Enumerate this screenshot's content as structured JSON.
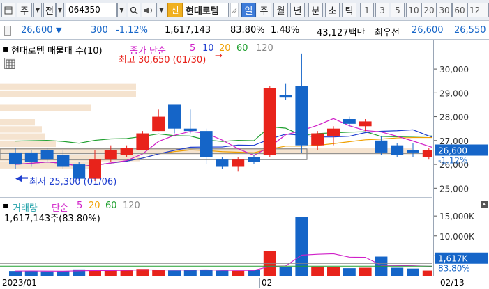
{
  "toolbar": {
    "type_label": "주",
    "exchange_label": "전",
    "code": "064350",
    "new_badge": "신",
    "stock_name": "현대로템",
    "periods": [
      "일",
      "주",
      "월",
      "년",
      "분",
      "초",
      "틱"
    ],
    "active_period": "일",
    "intervals": [
      "1",
      "3",
      "5",
      "10",
      "20",
      "30",
      "60",
      "12"
    ]
  },
  "info": {
    "price": "26,600",
    "change_arrow": "▼",
    "change": "300",
    "change_pct": "-1.12%",
    "volume": "1,617,143",
    "vol_ratio": "83.80%",
    "turnover": "1.48%",
    "trade_value": "43,127백만",
    "best_offer_label": "최우선",
    "best_ask": "26,600",
    "best_bid": "26,550"
  },
  "price_panel": {
    "title": "현대로템 매물대 수(10)",
    "ma_label": "종가 단순",
    "ma_periods": [
      "5",
      "10",
      "20",
      "60",
      "120"
    ],
    "high_note": "최고 30,650 (01/30)",
    "low_note": "최저 25,300 (01/06)",
    "y_ticks": [
      "30,000",
      "29,000",
      "28,000",
      "27,000",
      "26,000",
      "25,000"
    ],
    "current_tag": "26,600",
    "change_tag": "-1.12%"
  },
  "volume_panel": {
    "title": "거래량",
    "ma_label": "단순",
    "ma_periods": [
      "5",
      "20",
      "60",
      "120"
    ],
    "value_text": "1,617,143주(83.80%)",
    "y_ticks": [
      "15,000K",
      "10,000K",
      "5,000K"
    ],
    "current_tag": "1,617K",
    "ratio_tag": "83.80%"
  },
  "date_axis": {
    "start": "2023/01",
    "mid": "02",
    "end": "02/13"
  },
  "colors": {
    "up": "#e8231b",
    "down": "#1565c8",
    "ma5": "#d01fc8",
    "ma10": "#1f3fd0",
    "ma20": "#f0a000",
    "ma60": "#20a030",
    "ma120": "#777777",
    "volume_profile": "#f5e3cf"
  },
  "chart_data": {
    "type": "candlestick",
    "dates": [
      "01/02",
      "01/03",
      "01/04",
      "01/05",
      "01/06",
      "01/09",
      "01/10",
      "01/11",
      "01/12",
      "01/13",
      "01/16",
      "01/17",
      "01/18",
      "01/19",
      "01/20",
      "01/25",
      "01/26",
      "01/27",
      "01/30",
      "01/31",
      "02/01",
      "02/02",
      "02/03",
      "02/06",
      "02/07",
      "02/08",
      "02/09",
      "02/10",
      "02/13"
    ],
    "candles": [
      {
        "open": 26500,
        "high": 26700,
        "low": 25800,
        "close": 26000
      },
      {
        "open": 26500,
        "high": 26600,
        "low": 25900,
        "close": 26100
      },
      {
        "open": 26600,
        "high": 26700,
        "low": 26100,
        "close": 26200
      },
      {
        "open": 26400,
        "high": 26600,
        "low": 25800,
        "close": 25900
      },
      {
        "open": 26000,
        "high": 26100,
        "low": 25300,
        "close": 25400
      },
      {
        "open": 25400,
        "high": 26600,
        "low": 25300,
        "close": 26200
      },
      {
        "open": 26200,
        "high": 26800,
        "low": 26100,
        "close": 26600
      },
      {
        "open": 26400,
        "high": 26800,
        "low": 26300,
        "close": 26700
      },
      {
        "open": 26600,
        "high": 27400,
        "low": 26600,
        "close": 27300
      },
      {
        "open": 27400,
        "high": 28300,
        "low": 27400,
        "close": 28000
      },
      {
        "open": 28500,
        "high": 28500,
        "low": 27300,
        "close": 27500
      },
      {
        "open": 27500,
        "high": 28300,
        "low": 27300,
        "close": 27400
      },
      {
        "open": 27400,
        "high": 27500,
        "low": 26000,
        "close": 26300
      },
      {
        "open": 26200,
        "high": 26300,
        "low": 25800,
        "close": 25900
      },
      {
        "open": 25900,
        "high": 26300,
        "low": 25700,
        "close": 26200
      },
      {
        "open": 26300,
        "high": 26400,
        "low": 26000,
        "close": 26100
      },
      {
        "open": 26400,
        "high": 29300,
        "low": 26300,
        "close": 29200
      },
      {
        "open": 28900,
        "high": 29400,
        "low": 28700,
        "close": 28800
      },
      {
        "open": 29300,
        "high": 30650,
        "low": 26500,
        "close": 26800
      },
      {
        "open": 26800,
        "high": 27400,
        "low": 26600,
        "close": 27300
      },
      {
        "open": 27200,
        "high": 27600,
        "low": 26800,
        "close": 27500
      },
      {
        "open": 27900,
        "high": 28000,
        "low": 27600,
        "close": 27700
      },
      {
        "open": 27600,
        "high": 27900,
        "low": 27400,
        "close": 27800
      },
      {
        "open": 27000,
        "high": 27200,
        "low": 26400,
        "close": 26500
      },
      {
        "open": 26800,
        "high": 26900,
        "low": 26300,
        "close": 26400
      },
      {
        "open": 26600,
        "high": 26900,
        "low": 26300,
        "close": 26500
      },
      {
        "open": 26300,
        "high": 26700,
        "low": 26200,
        "close": 26600
      },
      {
        "open": 26600,
        "high": 26900,
        "low": 26400,
        "close": 26800
      },
      {
        "open": 26900,
        "high": 27000,
        "low": 26300,
        "close": 26600
      }
    ],
    "volumes_k": [
      1200,
      1250,
      1100,
      1150,
      1600,
      1500,
      1300,
      1350,
      1700,
      1500,
      1350,
      1400,
      1500,
      1300,
      1250,
      1400,
      6200,
      2200,
      14800,
      2300,
      2100,
      1900,
      2000,
      4800,
      2000,
      1800,
      1300,
      1900,
      1617
    ],
    "ylim": [
      24600,
      31200
    ],
    "vol_ylim": [
      0,
      18000
    ]
  }
}
